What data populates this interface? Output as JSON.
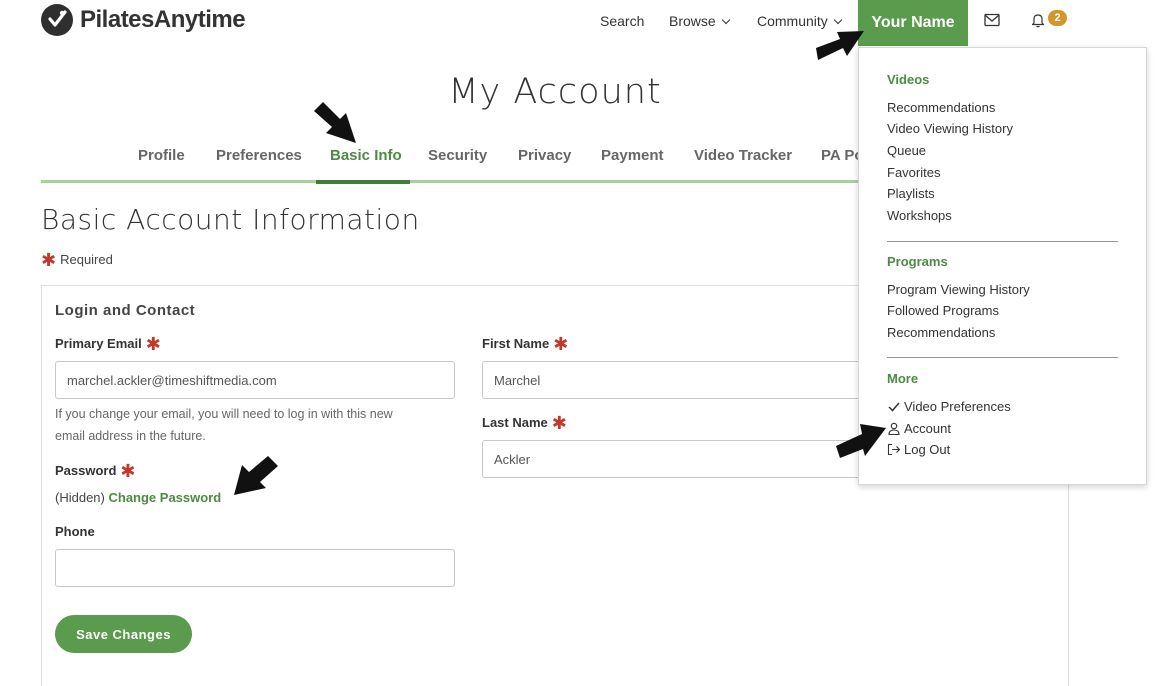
{
  "brand": {
    "name": "PilatesAnytime"
  },
  "topnav": {
    "search": "Search",
    "browse": "Browse",
    "community": "Community",
    "user": "Your Name",
    "notification_count": "2"
  },
  "page": {
    "title": "My Account"
  },
  "tabs": [
    {
      "label": "Profile"
    },
    {
      "label": "Preferences"
    },
    {
      "label": "Basic Info"
    },
    {
      "label": "Security"
    },
    {
      "label": "Privacy"
    },
    {
      "label": "Payment"
    },
    {
      "label": "Video Tracker"
    },
    {
      "label": "PA Po"
    }
  ],
  "active_tab": "Basic Info",
  "section": {
    "title": "Basic Account Information",
    "required_note": "Required"
  },
  "form": {
    "card_title": "Login and Contact",
    "email_label": "Primary Email",
    "email_value": "marchel.ackler@timeshiftmedia.com",
    "email_help_1": "If you change your email, you will need to log in with this new",
    "email_help_2": "email address in the future.",
    "password_label": "Password",
    "password_hidden": "(Hidden)",
    "password_link": "Change Password",
    "phone_label": "Phone",
    "phone_value": "",
    "first_name_label": "First Name",
    "first_name_value": "Marchel",
    "last_name_label": "Last Name",
    "last_name_value": "Ackler",
    "save_label": "Save Changes"
  },
  "menu": {
    "videos_head": "Videos",
    "videos": [
      "Recommendations",
      "Video Viewing History",
      "Queue",
      "Favorites",
      "Playlists",
      "Workshops"
    ],
    "programs_head": "Programs",
    "programs": [
      "Program Viewing History",
      "Followed Programs",
      "Recommendations"
    ],
    "more_head": "More",
    "more": [
      "Video Preferences",
      "Account",
      "Log Out"
    ]
  },
  "colors": {
    "accent_green": "#5a9b4e",
    "link_green": "#4d8a43",
    "required_red": "#c0392b",
    "badge_orange": "#d4952a"
  }
}
